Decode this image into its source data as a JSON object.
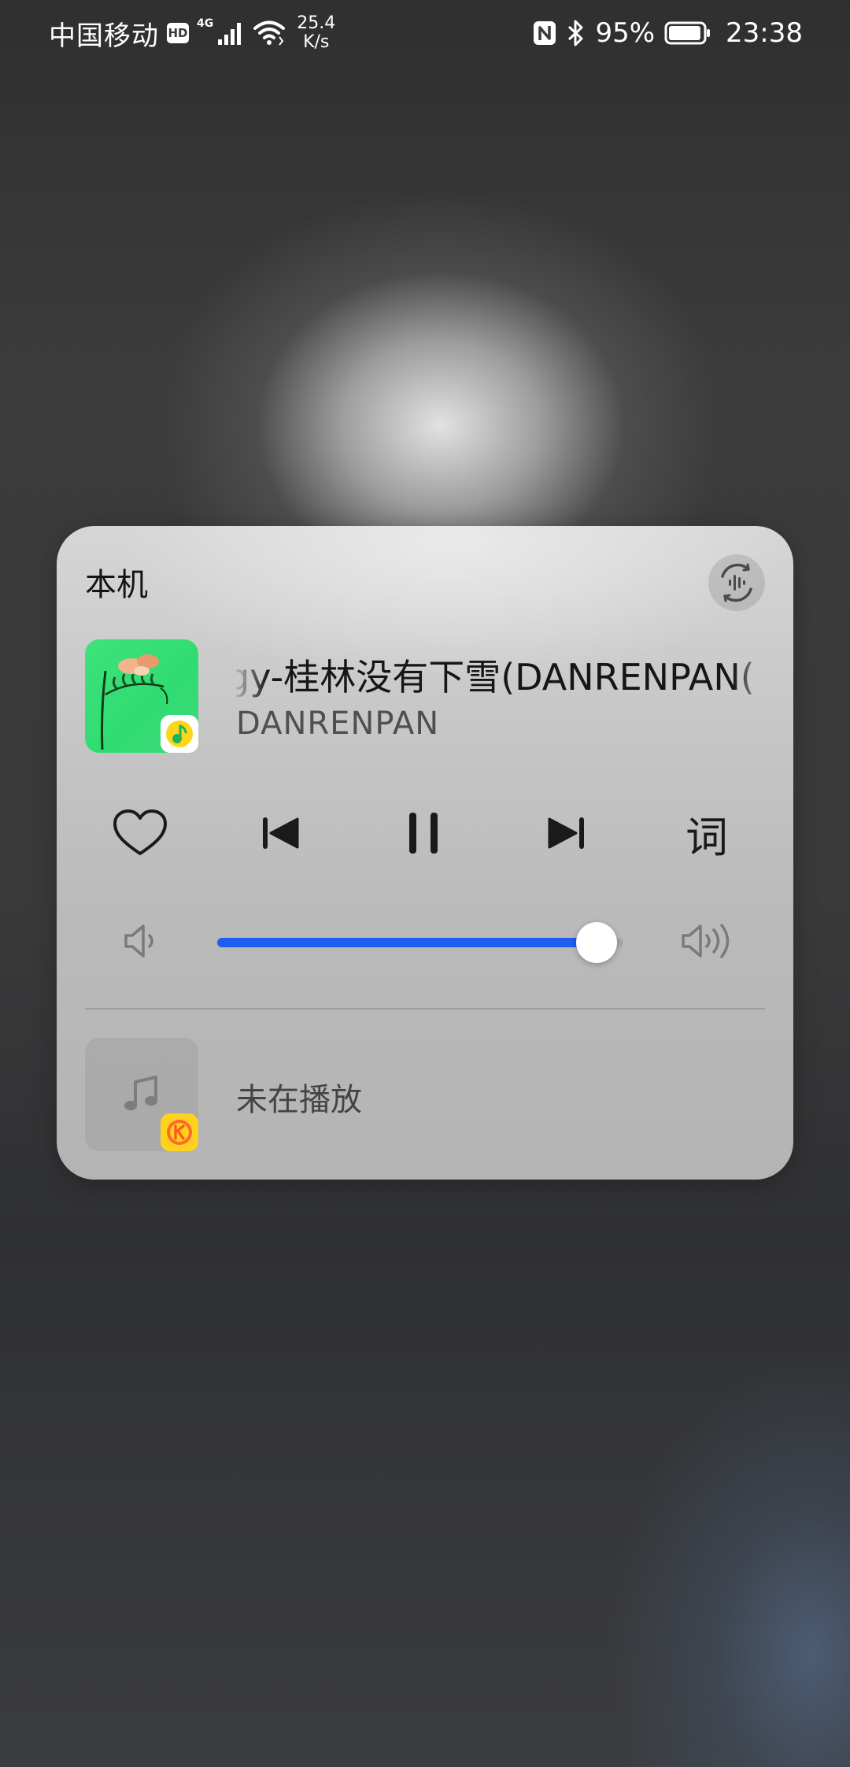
{
  "status_bar": {
    "carrier": "中国移动",
    "hd_badge": "HD",
    "network_type": "4G",
    "speed_value": "25.4",
    "speed_unit": "K/s",
    "battery_percent": "95%",
    "battery_level": 0.95,
    "time": "23:38",
    "icons": [
      "signal-icon",
      "wifi-icon",
      "nfc-icon",
      "bluetooth-icon",
      "battery-icon"
    ]
  },
  "media_card": {
    "device_label": "本机",
    "cast_icon": "audio-wave-cast-icon",
    "now_playing": {
      "title": "gy-桂林没有下雪(DANRENPAN(",
      "artist": "DANRENPAN",
      "app_badge": "qq-music-icon"
    },
    "controls": {
      "like_icon": "heart-icon",
      "prev_icon": "previous-track-icon",
      "pause_icon": "pause-icon",
      "next_icon": "next-track-icon",
      "lyrics_label": "词"
    },
    "volume": {
      "level": 0.935,
      "low_icon": "volume-low-icon",
      "high_icon": "volume-high-icon",
      "accent_color": "#1f5cf0"
    },
    "second_session": {
      "status": "未在播放",
      "placeholder_icon": "music-note-icon",
      "app_badge": "kugou-icon"
    }
  }
}
